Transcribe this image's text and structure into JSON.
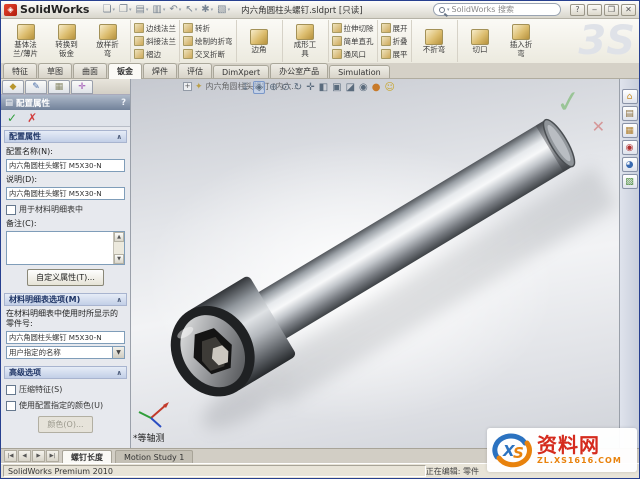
{
  "window": {
    "app_name": "SolidWorks",
    "logo_glyph": "◈",
    "doc_title": "内六角圆柱头螺钉.sldprt [只读]",
    "search_placeholder": "SolidWorks 搜索",
    "help_btn": "?",
    "min_btn": "‒",
    "max_btn": "❐",
    "close_btn": "✕",
    "brand_3s": "3S"
  },
  "quick_access": {
    "caret": "▾",
    "items": [
      {
        "name": "new-file",
        "glyph": "❏"
      },
      {
        "name": "open-file",
        "glyph": "❐"
      },
      {
        "name": "save",
        "glyph": "▤"
      },
      {
        "name": "print",
        "glyph": "▥"
      },
      {
        "name": "undo",
        "glyph": "↶"
      },
      {
        "name": "select",
        "glyph": "↖"
      },
      {
        "name": "rebuild",
        "glyph": "✱"
      },
      {
        "name": "options",
        "glyph": "▧"
      }
    ]
  },
  "command_tabs": {
    "items": [
      {
        "label": "特征"
      },
      {
        "label": "草图"
      },
      {
        "label": "曲面"
      },
      {
        "label": "钣金",
        "active": true
      },
      {
        "label": "焊件"
      },
      {
        "label": "评估"
      },
      {
        "label": "DimXpert"
      },
      {
        "label": "办公室产品"
      },
      {
        "label": "Simulation"
      }
    ]
  },
  "ribbon": {
    "groups": [
      {
        "items": [
          {
            "label": "基体法\n兰/薄片"
          },
          {
            "label": "转换到\n钣金"
          },
          {
            "label": "放样折\n弯"
          }
        ]
      },
      {
        "items": [
          {
            "label": "边线法兰"
          },
          {
            "label": "斜接法兰"
          },
          {
            "label": "褶边"
          }
        ]
      },
      {
        "items": [
          {
            "label": "转折"
          },
          {
            "label": "绘制的折弯"
          },
          {
            "label": "交叉折断"
          }
        ]
      },
      {
        "items": [
          {
            "label": "边角"
          }
        ]
      },
      {
        "items": [
          {
            "label": "成形工\n具"
          }
        ]
      },
      {
        "items": [
          {
            "label": "拉伸切除"
          },
          {
            "label": "简单直孔"
          },
          {
            "label": "通风口"
          }
        ]
      },
      {
        "items": [
          {
            "label": "展开"
          },
          {
            "label": "折叠"
          },
          {
            "label": "展平"
          }
        ]
      },
      {
        "items": [
          {
            "label": "不折弯"
          }
        ]
      },
      {
        "items": [
          {
            "label": "切口"
          },
          {
            "label": "插入折\n弯"
          }
        ]
      }
    ]
  },
  "panel_tabs": {
    "items": [
      {
        "name": "feature-manager-tab",
        "glyph": "◆",
        "color": "#b8962e"
      },
      {
        "name": "property-manager-tab",
        "glyph": "✎",
        "color": "#4a6ea8"
      },
      {
        "name": "configuration-manager-tab",
        "glyph": "▦",
        "color": "#8a8a6a"
      },
      {
        "name": "dimxpert-manager-tab",
        "glyph": "✛",
        "color": "#9a4ab0"
      }
    ]
  },
  "property_manager": {
    "title": "配置属性",
    "title_icon": "▤",
    "help": "?",
    "ok_icon": "✓",
    "cancel_icon": "✗",
    "chevron": "∧",
    "scroll_up": "▲",
    "scroll_down": "▼",
    "config": {
      "header": "配置属性",
      "name_label": "配置名称(N):",
      "name_value": "内六角圆柱头螺钉 M5X30-N",
      "desc_label": "说明(D):",
      "desc_value": "内六角圆柱头螺钉 M5X30-N",
      "bom_checkbox": "用于材料明细表中",
      "comment_label": "备注(C):",
      "comment_value": "",
      "custom_props_button": "自定义属性(T)..."
    },
    "bom": {
      "header": "材料明细表选项(M)",
      "part_no_text": "在材料明细表中使用时所显示的零件号:",
      "part_no_value": "内六角圆柱头螺钉 M5X30-N",
      "source_dropdown": "用户指定的名称",
      "dropdown_caret": "▼"
    },
    "advanced": {
      "header": "高级选项",
      "suppress_checkbox": "压缩特征(S)",
      "color_checkbox": "使用配置指定的颜色(U)",
      "color_button": "颜色(O)..."
    }
  },
  "viewport": {
    "flyout": {
      "expander": "+",
      "part_icon": "✦",
      "label": "内六角圆柱头螺钉 (内六..."
    },
    "view_label": "*等轴测",
    "confirm_ok": "✓",
    "confirm_cancel": "✕",
    "hud": {
      "caret": "▾",
      "items": [
        {
          "name": "previous-view",
          "glyph": "↧"
        },
        {
          "name": "zoom-to-fit",
          "glyph": "◈",
          "hl": true
        },
        {
          "name": "zoom-in",
          "glyph": "⊕"
        },
        {
          "name": "zoom-area",
          "glyph": "⊙"
        },
        {
          "name": "rotate-view",
          "glyph": "↻"
        },
        {
          "name": "pan",
          "glyph": "✛"
        },
        {
          "name": "section-view",
          "glyph": "◧",
          "caret": true
        },
        {
          "name": "view-orientation",
          "glyph": "▣",
          "caret": true
        },
        {
          "name": "display-style",
          "glyph": "◪",
          "caret": true
        },
        {
          "name": "hide-show-items",
          "glyph": "◉",
          "caret": true
        },
        {
          "name": "edit-appearance",
          "glyph": "●",
          "caret": true,
          "color": "#c87a2a"
        },
        {
          "name": "apply-scene",
          "glyph": "☺",
          "caret": true,
          "color": "#c8a52a"
        }
      ]
    }
  },
  "task_pane": {
    "items": [
      {
        "name": "solidworks-resources-icon",
        "glyph": "⌂",
        "color": "#c98f2a"
      },
      {
        "name": "design-library-icon",
        "glyph": "▤",
        "color": "#8a6d3b"
      },
      {
        "name": "file-explorer-icon",
        "glyph": "▦",
        "color": "#b08030"
      },
      {
        "name": "search-results-icon",
        "glyph": "◉",
        "color": "#b03030"
      },
      {
        "name": "view-palette-icon",
        "glyph": "◕",
        "color": "#3a6ab0"
      },
      {
        "name": "appearances-scenes-icon",
        "glyph": "▧",
        "color": "#4a8a3a"
      }
    ]
  },
  "bottom_bar": {
    "nav": {
      "items": [
        {
          "glyph": "|◀"
        },
        {
          "glyph": "◀"
        },
        {
          "glyph": "▶"
        },
        {
          "glyph": "▶|"
        }
      ]
    },
    "tabs": {
      "items": [
        {
          "label": "螺钉长度",
          "active": true
        },
        {
          "label": "Motion Study 1"
        }
      ]
    }
  },
  "status_bar": {
    "left": "SolidWorks Premium 2010",
    "right": "正在编辑: 零件"
  },
  "watermark": {
    "logo_text": "XS",
    "site": "资料网",
    "url": "ZL.XS1616.COM"
  },
  "colors": {
    "accent_red": "#d52b1e",
    "accent_orange": "#e8820c",
    "brand_blue": "#2b72c0",
    "check_green": "#2e9e3a",
    "cross_red": "#d23c3c"
  }
}
